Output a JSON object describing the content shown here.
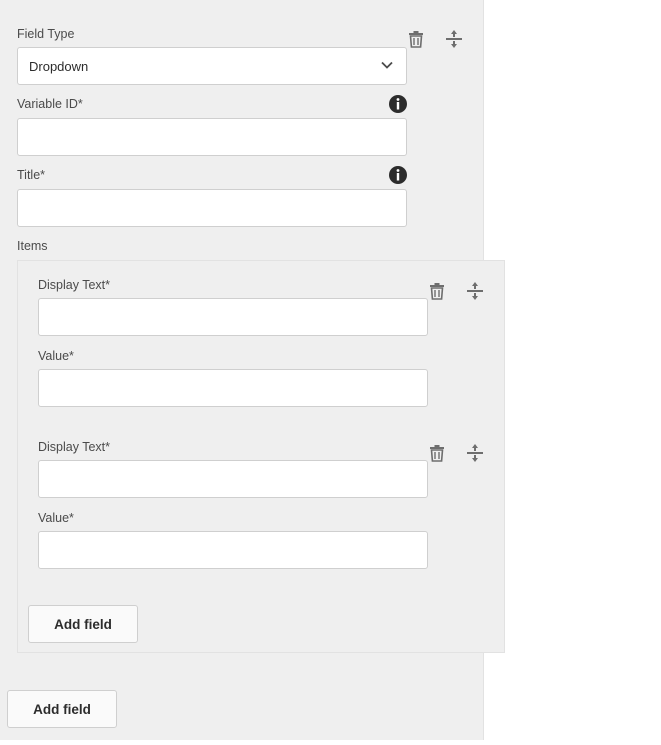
{
  "field_type": {
    "label": "Field Type",
    "selected": "Dropdown"
  },
  "variable_id": {
    "label": "Variable ID*",
    "value": ""
  },
  "title": {
    "label": "Title*",
    "value": ""
  },
  "items": {
    "label": "Items",
    "entries": [
      {
        "display_text_label": "Display Text*",
        "display_text_value": "",
        "value_label": "Value*",
        "value_value": ""
      },
      {
        "display_text_label": "Display Text*",
        "display_text_value": "",
        "value_label": "Value*",
        "value_value": ""
      }
    ],
    "add_button_label": "Add field"
  },
  "add_button_label": "Add field",
  "icons": {
    "delete": "trash-icon",
    "reorder": "drag-handle-icon",
    "info": "info-icon",
    "dropdown": "chevron-down-icon"
  }
}
